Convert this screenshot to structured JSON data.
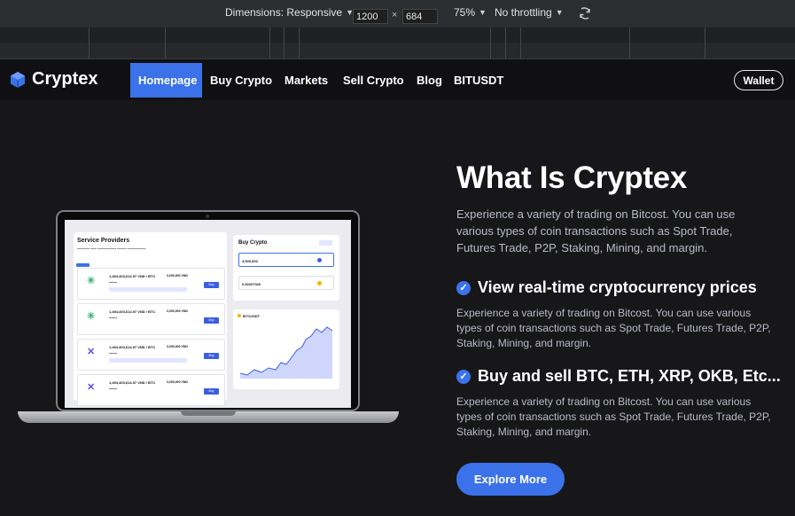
{
  "devtools": {
    "dimensions_label": "Dimensions: Responsive",
    "width": "1200",
    "x_sep": "×",
    "height": "684",
    "zoom": "75%",
    "throttling": "No throttling"
  },
  "nav": {
    "brand": "Cryptex",
    "links": [
      "Homepage",
      "Buy Crypto",
      "Markets",
      "Sell Crypto",
      "Blog",
      "BITUSDT"
    ],
    "wallet": "Wallet"
  },
  "hero": {
    "title": "What Is Cryptex",
    "intro_lines": [
      "Experience a variety of trading on Bitcost. You can use",
      "various types of coin transactions such as Spot Trade,",
      "Futures Trade, P2P, Staking, Mining, and margin."
    ],
    "features": [
      {
        "title": "View real-time cryptocurrency prices",
        "lines": [
          "Experience a variety of trading on Bitcost. You can use various",
          "types of coin transactions such as Spot Trade, Futures Trade, P2P,",
          "Staking, Mining, and margin."
        ]
      },
      {
        "title": "Buy and sell BTC, ETH, XRP, OKB, Etc...",
        "lines": [
          "Experience a variety of trading on Bitcost. You can use various",
          "types of coin transactions such as Spot Trade, Futures Trade, P2P,",
          "Staking, Mining, and margin."
        ]
      }
    ],
    "cta": "Explore More"
  },
  "laptop_ui": {
    "service_providers": "Service Providers",
    "cards": [
      {
        "price": "1,494,403,614.97 VND / BTC",
        "volume": "3,000,000 VND"
      },
      {
        "price": "1,494,403,614.97 VND / BTC",
        "volume": "3,000,000 VND"
      },
      {
        "price": "1,494,403,614.97 VND / BTC",
        "volume": "3,000,000 VND"
      },
      {
        "price": "1,494,403,614.97 VND / BTC",
        "volume": "3,000,000 VND"
      }
    ],
    "buy_label": "Buy",
    "buy_crypto": "Buy Crypto",
    "pay_amount": "3,000,000",
    "receive_amount": "0.00207026",
    "chart_title": "BTCUSDT"
  },
  "colors": {
    "accent": "#3b72ea",
    "background": "#17171a",
    "nav": "#101012",
    "body_text": "#b8bcc6"
  }
}
